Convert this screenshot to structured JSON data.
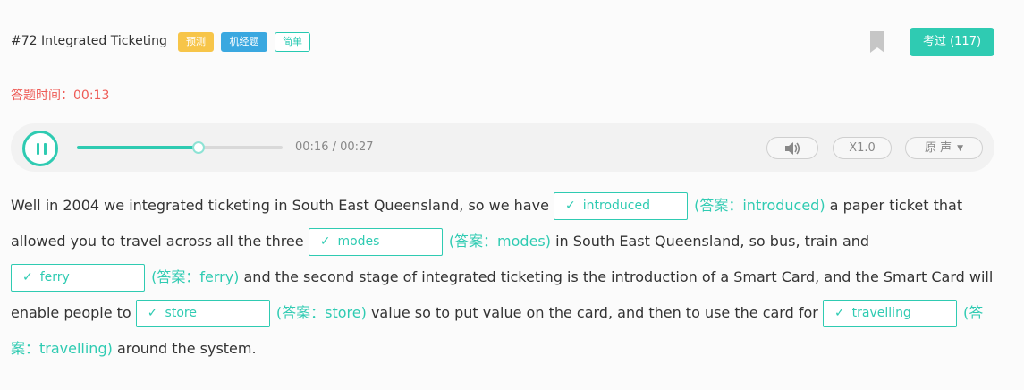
{
  "header": {
    "title": "#72 Integrated Ticketing",
    "tags": {
      "predict": "预测",
      "machine": "机经题",
      "difficulty": "简单"
    },
    "tested_button": "考过 (117)",
    "bookmark_icon": "bookmark-icon"
  },
  "timer": {
    "label": "答题时间：",
    "value": "00:13"
  },
  "player": {
    "progress": 0.59,
    "time": "00:16 / 00:27",
    "speed": "X1.0",
    "voice": "原 声",
    "icons": {
      "play": "pause-icon",
      "volume": "volume-icon",
      "chevron": "chevron-down-icon"
    }
  },
  "colors": {
    "accent": "#2fcbb2",
    "timer": "#ee5a55",
    "tag_predict": "#f7c549",
    "tag_machine": "#3aa8e0"
  },
  "transcript": {
    "check": "✓",
    "s1": "Well in 2004 we integrated ticketing in South East Queensland, so we have",
    "blank1": "introduced",
    "answer1": "(答案：introduced)",
    "s2": "a paper ticket that allowed you to travel across all the three",
    "blank2": "modes",
    "answer2": "(答案：modes)",
    "s3": "in South East Queensland, so bus, train and",
    "blank3": "ferry",
    "answer3": "(答案：ferry)",
    "s4": "and the second stage of integrated ticketing is the introduction of a Smart Card, and the Smart Card will enable people to",
    "blank4": "store",
    "answer4": "(答案：store)",
    "s5": "value so to put value on the card, and then to use the card for",
    "blank5": "travelling",
    "answer5": "(答案：travelling)",
    "s6": "around the system."
  }
}
